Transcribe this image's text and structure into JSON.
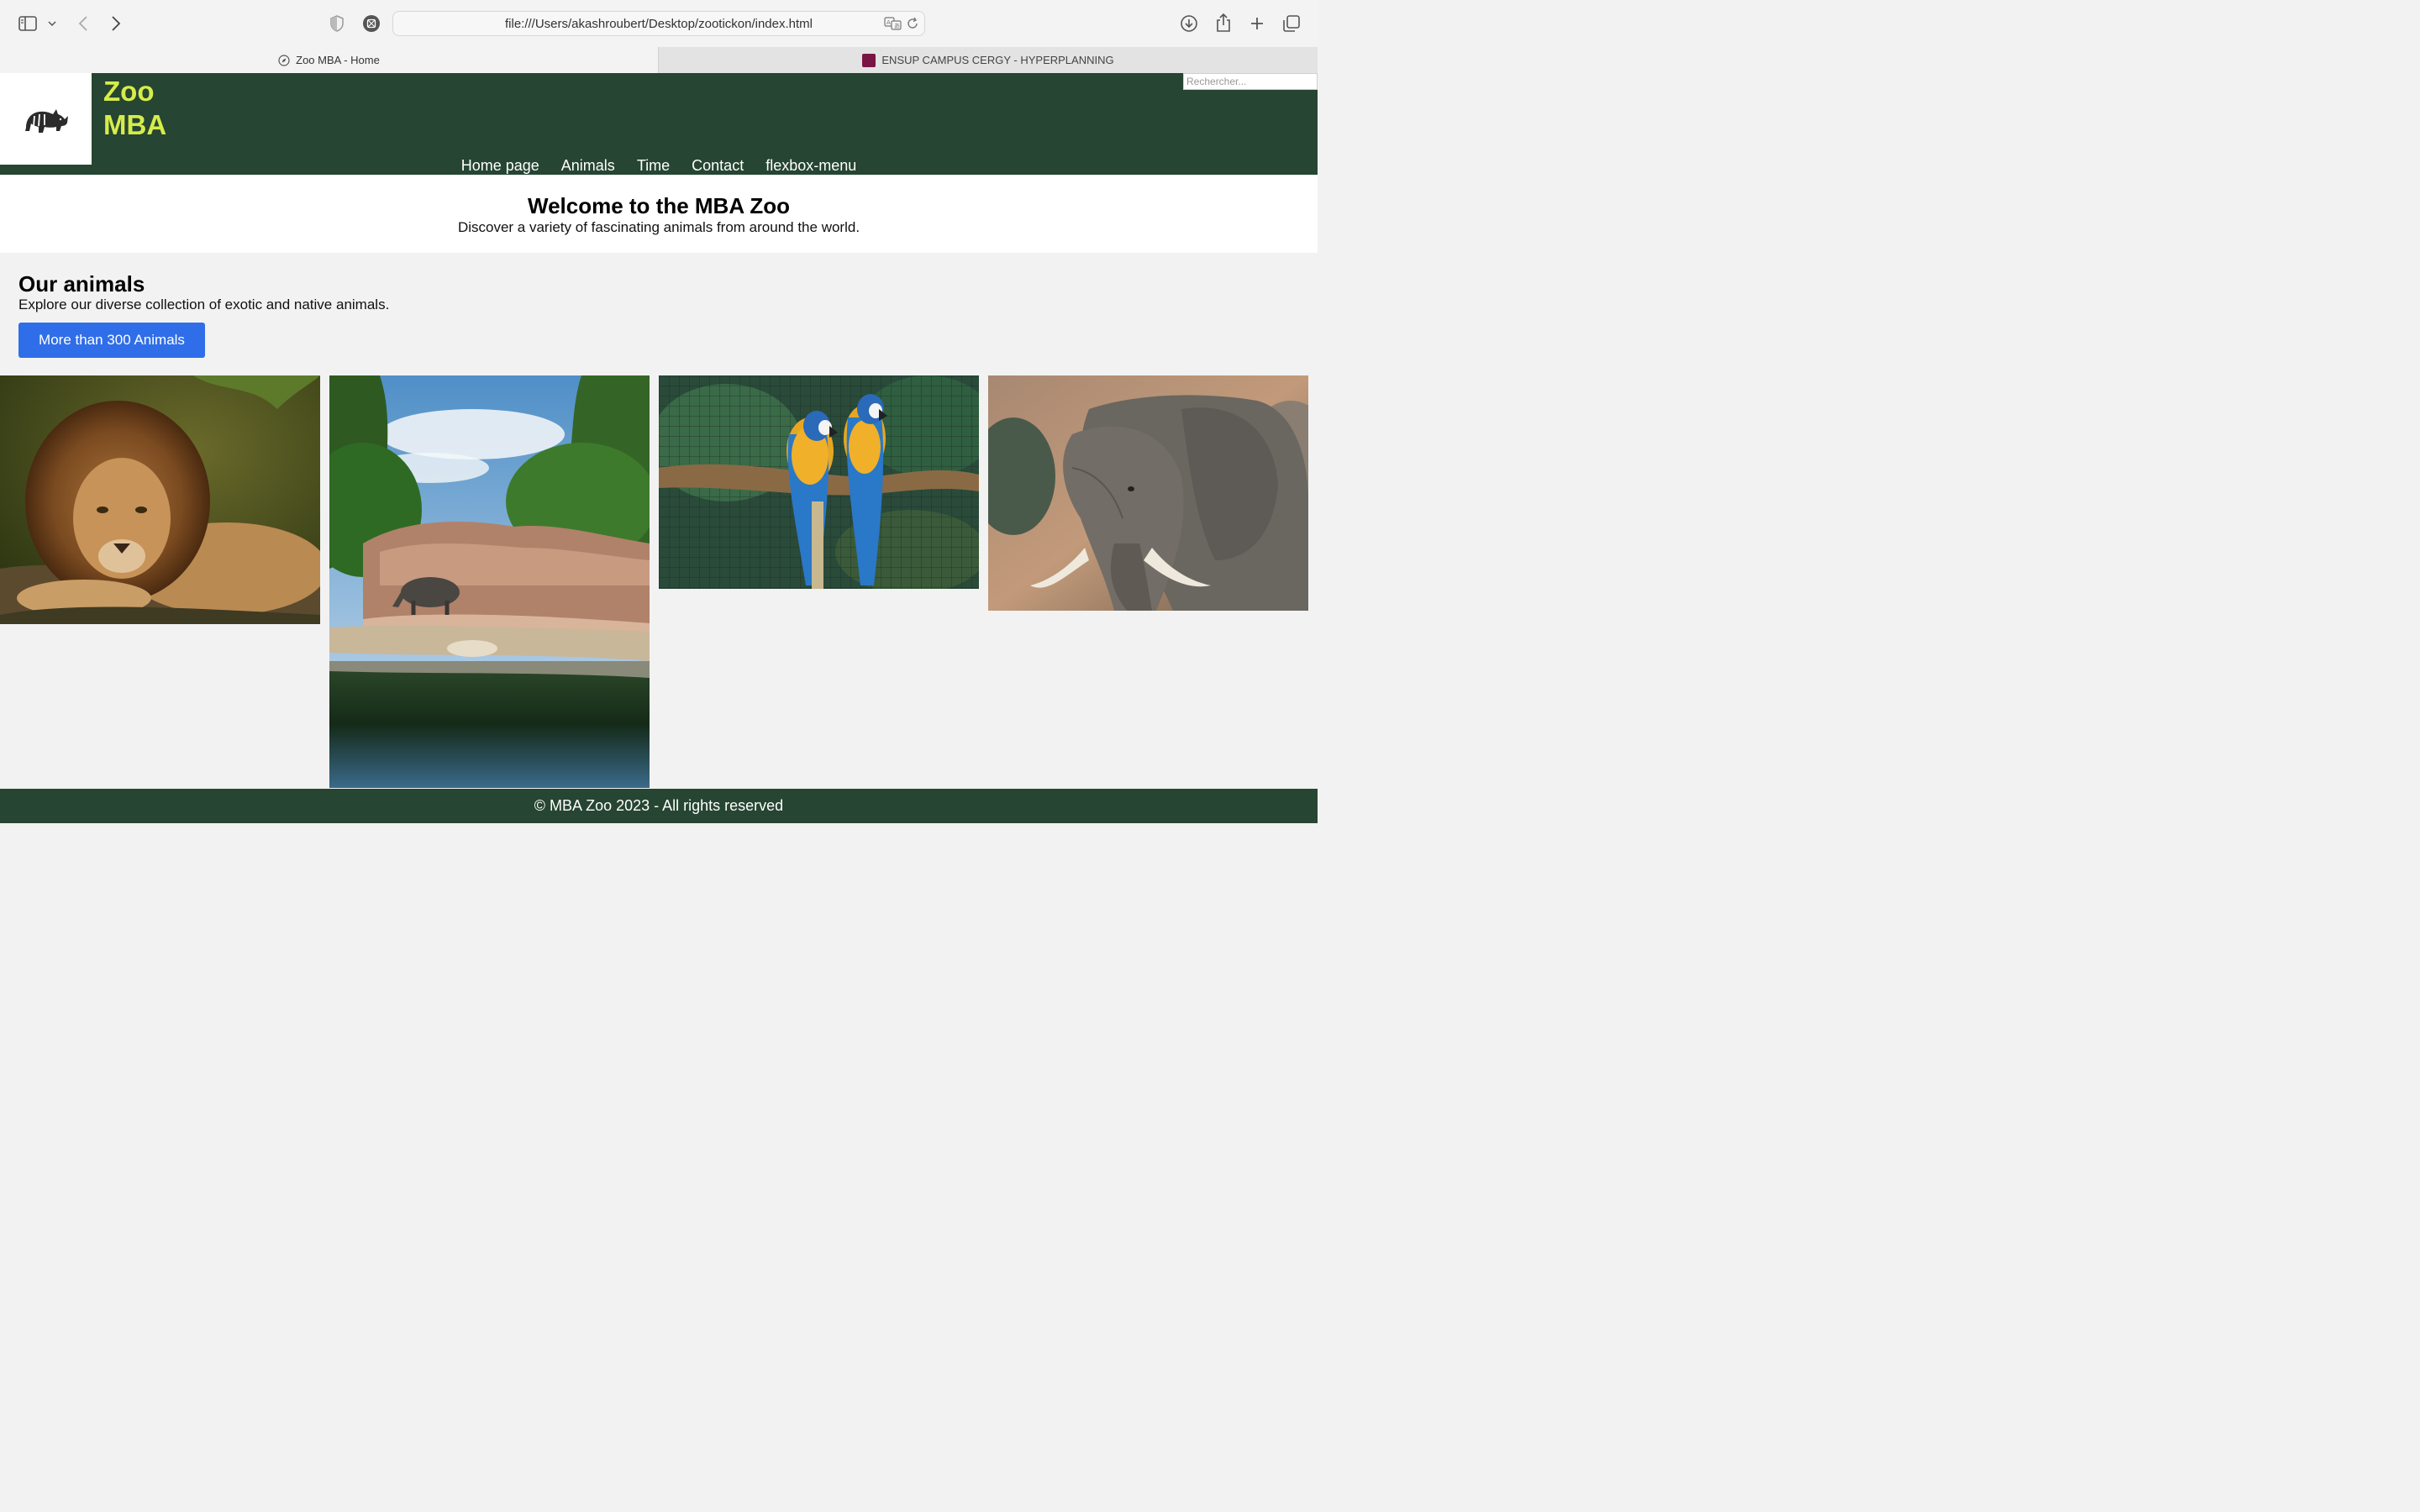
{
  "browser": {
    "url": "file:///Users/akashroubert/Desktop/zootickon/index.html",
    "tabs": [
      {
        "title": "Zoo MBA - Home",
        "active": true
      },
      {
        "title": "ENSUP CAMPUS CERGY - HYPERPLANNING",
        "active": false
      }
    ]
  },
  "header": {
    "brand_line1": "Zoo",
    "brand_line2": "MBA",
    "search_placeholder": "Rechercher...",
    "nav": [
      "Home page",
      "Animals",
      "Time",
      "Contact",
      "flexbox-menu"
    ]
  },
  "hero": {
    "title": "Welcome to the MBA Zoo",
    "subtitle": "Discover a variety of fascinating animals from around the world."
  },
  "animals": {
    "title": "Our animals",
    "description": "Explore our diverse collection of exotic and native animals.",
    "button": "More than 300 Animals",
    "images": [
      "lion",
      "rhinoceros-enclosure",
      "macaws",
      "elephant"
    ]
  },
  "footer": {
    "text": "© MBA Zoo 2023 - All rights reserved"
  },
  "colors": {
    "header_bg": "#264532",
    "brand": "#d6ec4a",
    "button": "#2f6ee8",
    "tab_favicon": "#7a1444"
  }
}
